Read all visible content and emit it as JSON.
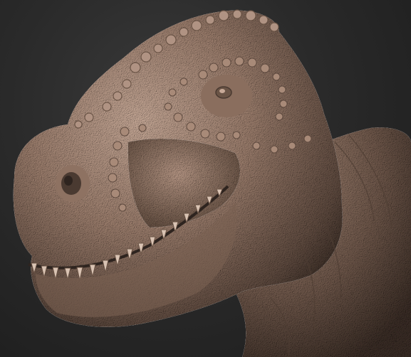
{
  "scene": {
    "subject": "dinosaur-head-sculpt",
    "colors": {
      "background_center": "#3a3a3a",
      "background_edge": "#1c1c1c",
      "clay_light": "#c8aa98",
      "clay_mid": "#9c7e6d",
      "clay_dark": "#5e4a3f",
      "clay_shadow": "#3a2d26",
      "teeth": "#d9c3b3"
    }
  }
}
